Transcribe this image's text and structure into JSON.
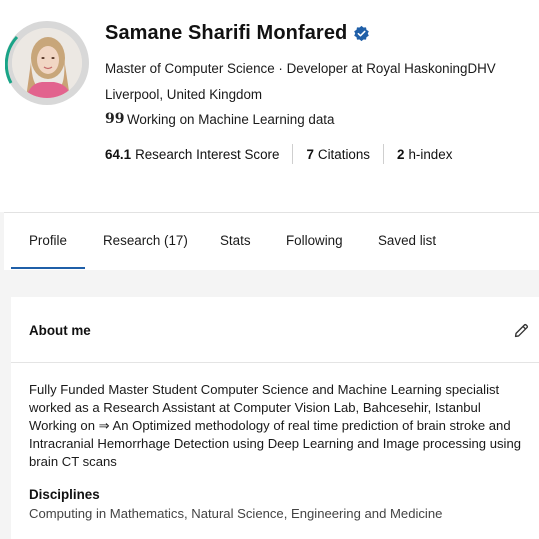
{
  "profile": {
    "name": "Samane Sharifi Monfared",
    "headline": "Master of Computer Science · Developer at Royal HaskoningDHV",
    "location": "Liverpool, United Kingdom",
    "status_icon": "quote-icon",
    "status": "Working on Machine Learning data",
    "verified_icon": "verified-badge-icon",
    "accent_color": "#1f5fa8",
    "ring_color": "#19a487"
  },
  "stats": [
    {
      "value": "64.1",
      "label": "Research Interest Score"
    },
    {
      "value": "7",
      "label": "Citations"
    },
    {
      "value": "2",
      "label": "h-index"
    }
  ],
  "tabs": [
    {
      "label": "Profile",
      "active": true
    },
    {
      "label": "Research (17)",
      "active": false
    },
    {
      "label": "Stats",
      "active": false
    },
    {
      "label": "Following",
      "active": false
    },
    {
      "label": "Saved list",
      "active": false
    }
  ],
  "about": {
    "title": "About me",
    "edit_icon": "pencil-icon",
    "lines": [
      "Fully Funded Master Student Computer Science and Machine Learning specialist",
      "worked as a Research Assistant at Computer Vision Lab, Bahcesehir, Istanbul",
      "Working on ⇒ An Optimized methodology of real time prediction of brain stroke and",
      "Intracranial Hemorrhage Detection using Deep Learning and Image processing using",
      "brain CT scans"
    ],
    "disciplines_title": "Disciplines",
    "disciplines": "Computing in Mathematics, Natural Science, Engineering and Medicine"
  }
}
